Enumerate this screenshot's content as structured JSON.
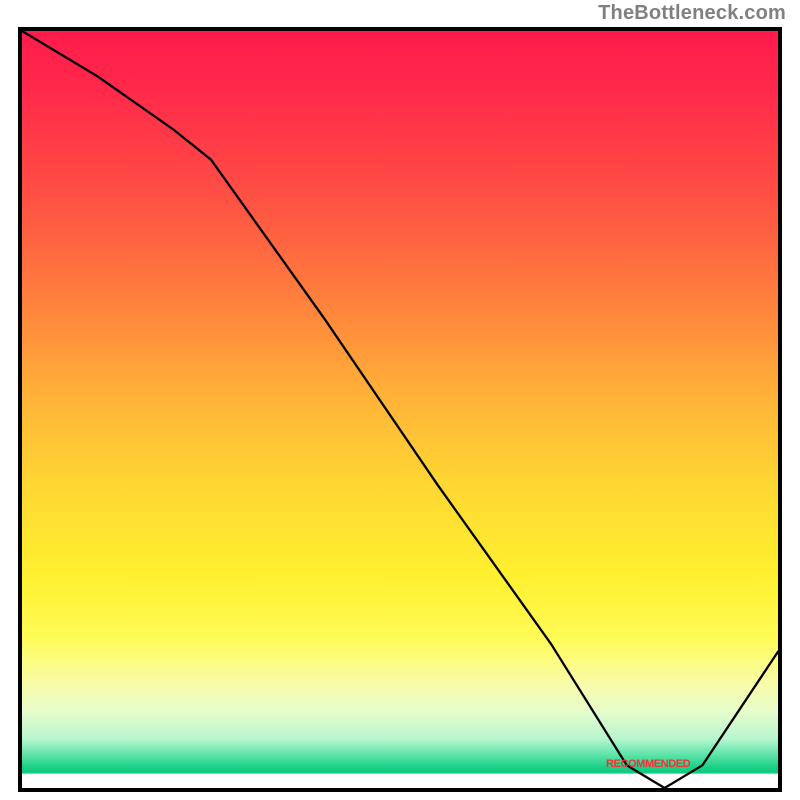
{
  "attribution": "TheBottleneck.com",
  "chart_data": {
    "type": "line",
    "title": "",
    "xlabel": "",
    "ylabel": "",
    "xlim": [
      0,
      100
    ],
    "ylim": [
      0,
      100
    ],
    "series": [
      {
        "name": "bottleneck-curve",
        "x": [
          0,
          10,
          20,
          25,
          40,
          55,
          70,
          80,
          85,
          90,
          100
        ],
        "values": [
          100,
          94,
          87,
          83,
          62,
          40,
          19,
          3,
          0,
          3,
          18
        ]
      }
    ],
    "annotations": [
      {
        "text": "RECOMMENDED",
        "x": 82,
        "y": 2
      }
    ],
    "gradient_background": {
      "orientation": "vertical",
      "stops": [
        {
          "pos": 0.0,
          "color": "#ff1b4b"
        },
        {
          "pos": 0.34,
          "color": "#ff7a3d"
        },
        {
          "pos": 0.6,
          "color": "#ffd733"
        },
        {
          "pos": 0.8,
          "color": "#fffb55"
        },
        {
          "pos": 0.93,
          "color": "#b7f6cf"
        },
        {
          "pos": 0.98,
          "color": "#0dc97e"
        },
        {
          "pos": 1.0,
          "color": "#ffffff"
        }
      ]
    }
  },
  "annotation_label": "RECOMMENDED"
}
